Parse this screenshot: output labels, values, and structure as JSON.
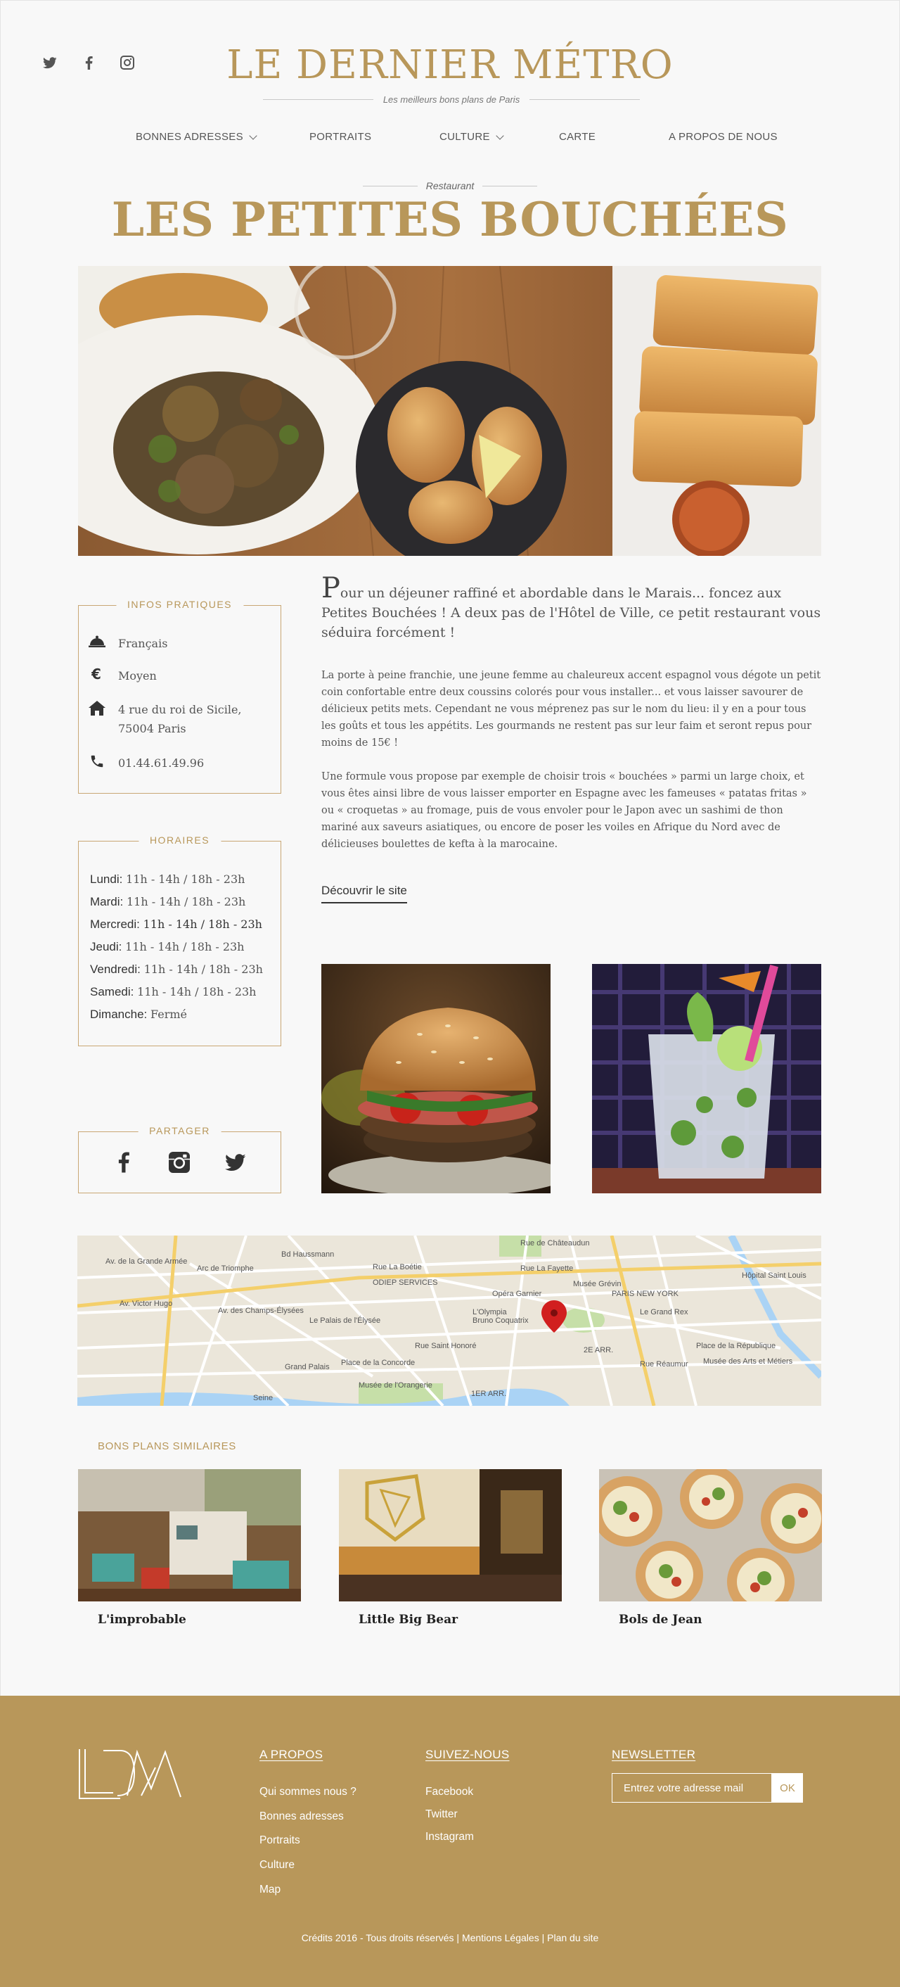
{
  "header": {
    "site_title": "LE DERNIER MÉTRO",
    "tagline": "Les meilleurs bons plans de Paris",
    "social_icons": [
      "twitter-icon",
      "facebook-icon",
      "instagram-icon"
    ]
  },
  "nav": {
    "items": [
      {
        "label": "BONNES ADRESSES",
        "dropdown": true
      },
      {
        "label": "PORTRAITS",
        "dropdown": false
      },
      {
        "label": "CULTURE",
        "dropdown": true
      },
      {
        "label": "CARTE",
        "dropdown": false
      },
      {
        "label": "A PROPOS DE NOUS",
        "dropdown": false
      }
    ]
  },
  "restaurant": {
    "category": "Restaurant",
    "name": "LES PETITES BOUCHÉES"
  },
  "infos": {
    "title": "INFOS  PRATIQUES",
    "cuisine": "Français",
    "price": "Moyen",
    "address_line1": "4 rue du roi de Sicile,",
    "address_line2": "75004 Paris",
    "phone": "01.44.61.49.96"
  },
  "horaires": {
    "title": "HORAIRES",
    "days": [
      {
        "day": "Lundi:",
        "hours": "11h - 14h / 18h - 23h"
      },
      {
        "day": "Mardi:",
        "hours": "11h - 14h / 18h - 23h"
      },
      {
        "day": "Mercredi:",
        "hours": "11h - 14h / 18h - 23h"
      },
      {
        "day": "Jeudi:",
        "hours": "11h - 14h / 18h - 23h"
      },
      {
        "day": "Vendredi:",
        "hours": "11h - 14h / 18h - 23h"
      },
      {
        "day": "Samedi:",
        "hours": "11h - 14h / 18h - 23h"
      },
      {
        "day": "Dimanche:",
        "hours": "Fermé"
      }
    ]
  },
  "share": {
    "title": "PARTAGER",
    "icons": [
      "facebook-icon",
      "instagram-icon",
      "twitter-icon"
    ]
  },
  "article": {
    "lead_dropcap": "P",
    "lead_rest": "our un déjeuner raffiné et abordable dans le Marais... foncez aux Petites Bouchées ! A deux pas de l'Hôtel de Ville, ce petit restaurant vous séduira forcément !",
    "paragraph1": "La porte à peine franchie, une jeune femme au chaleureux accent espagnol vous dégote un petit coin confortable entre deux coussins colorés pour vous installer... et vous laisser savourer de délicieux petits mets. Cependant ne vous méprenez pas sur le nom du lieu: il y en a pour tous les goûts et tous les appétits. Les gourmands ne restent pas sur leur faim et seront repus pour moins de 15€ !",
    "paragraph2": "Une formule vous propose par exemple de choisir trois « bouchées » parmi un large choix, et vous êtes ainsi libre de vous laisser emporter en Espagne avec les fameuses « patatas fritas » ou « croquetas » au fromage, puis de vous envoler pour le Japon avec un sashimi de thon mariné aux saveurs asiatiques, ou encore de poser les voiles en Afrique du Nord avec de délicieuses boulettes de kefta à la marocaine.",
    "discover_label": "Découvrir le site"
  },
  "map": {
    "labels": [
      "Arc de Triomphe",
      "Bd Haussmann",
      "Rue de Châteaudun",
      "Rue La Fayette",
      "ODIEP SERVICES",
      "Opéra Garnier",
      "Musée Grévin",
      "PARIS NEW YORK",
      "L'Olympia",
      "Bruno Coquatrix",
      "Le Grand Rex",
      "Hôpital Saint Louis",
      "Le Palais de l'Élysée",
      "Av. des Champs-Élysées",
      "Grand Palais",
      "Place de la Concorde",
      "Place de la République",
      "Musée des Arts et Métiers",
      "Musée de l'Orangerie",
      "Seine",
      "2E ARR.",
      "1ER ARR.",
      "Rue Réaumur",
      "Rue Saint Honoré",
      "Rue La Boétie",
      "Av. Victor Hugo",
      "Av. de la Grande Armée"
    ]
  },
  "similar": {
    "title": "BONS PLANS SIMILAIRES",
    "items": [
      {
        "name": "L'improbable"
      },
      {
        "name": "Little Big Bear"
      },
      {
        "name": "Bols de Jean"
      }
    ]
  },
  "footer": {
    "logo_text": "LDM",
    "col1_title": "A PROPOS",
    "col1_links": [
      "Qui sommes nous ?",
      "Bonnes adresses",
      "Portraits",
      "Culture",
      "Map"
    ],
    "col2_title": "SUIVEZ-NOUS",
    "col2_links": [
      "Facebook",
      "Twitter",
      "Instagram"
    ],
    "col3_title": "NEWSLETTER",
    "newsletter_placeholder": "Entrez votre adresse mail",
    "newsletter_button": "OK",
    "credits": "Crédits 2016 - Tous droits réservés",
    "legal": "Mentions Légales",
    "sitemap": "Plan du site",
    "separator": " | "
  },
  "colors": {
    "accent_gold": "#b8975a",
    "background": "#f8f8f8",
    "map_pin": "#d11f1f"
  }
}
